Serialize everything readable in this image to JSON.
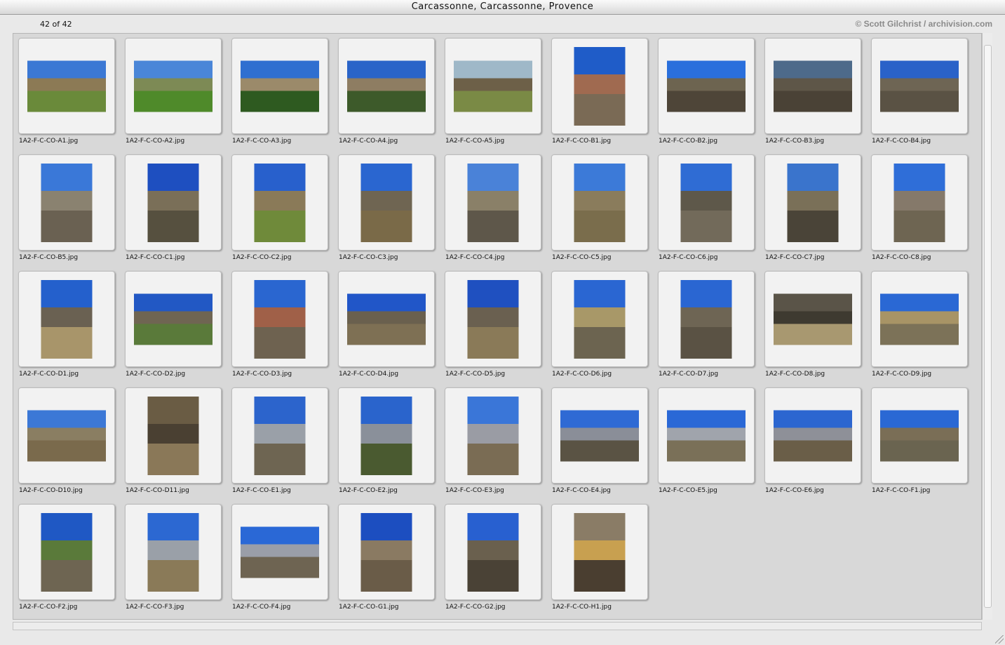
{
  "window": {
    "title": "Carcassonne, Carcassonne, Provence"
  },
  "header": {
    "counter": "42 of 42",
    "credit": "© Scott Gilchrist / archivision.com"
  },
  "thumbnails": [
    {
      "file": "1A2-F-C-CO-A1.jpg",
      "orient": "landscape",
      "sky": "#3b78d4",
      "fill": "#6a8a3a",
      "band": "#8c7a55"
    },
    {
      "file": "1A2-F-C-CO-A2.jpg",
      "orient": "landscape",
      "sky": "#4a86d8",
      "fill": "#4f8a2a",
      "band": "#7d8a55"
    },
    {
      "file": "1A2-F-C-CO-A3.jpg",
      "orient": "landscape",
      "sky": "#2f6fd0",
      "fill": "#2e5a20",
      "band": "#9b8a6a"
    },
    {
      "file": "1A2-F-C-CO-A4.jpg",
      "orient": "landscape",
      "sky": "#2a64c8",
      "fill": "#3d5a2a",
      "band": "#8e7d62"
    },
    {
      "file": "1A2-F-C-CO-A5.jpg",
      "orient": "landscape",
      "sky": "#9fb8c8",
      "fill": "#7a8a45",
      "band": "#6d6048"
    },
    {
      "file": "1A2-F-C-CO-B1.jpg",
      "orient": "portrait",
      "sky": "#1f5cc8",
      "fill": "#7a6a55",
      "band": "#a06a50"
    },
    {
      "file": "1A2-F-C-CO-B2.jpg",
      "orient": "landscape",
      "sky": "#2a6fdc",
      "fill": "#4e4538",
      "band": "#6d6450"
    },
    {
      "file": "1A2-F-C-CO-B3.jpg",
      "orient": "landscape",
      "sky": "#4d6a8a",
      "fill": "#4a4236",
      "band": "#5e5648"
    },
    {
      "file": "1A2-F-C-CO-B4.jpg",
      "orient": "landscape",
      "sky": "#2a62c8",
      "fill": "#5a5244",
      "band": "#6e6554"
    },
    {
      "file": "1A2-F-C-CO-B5.jpg",
      "orient": "portrait",
      "sky": "#3a78d8",
      "fill": "#6a6152",
      "band": "#8a8270"
    },
    {
      "file": "1A2-F-C-CO-C1.jpg",
      "orient": "portrait",
      "sky": "#1e4fc0",
      "fill": "#56503f",
      "band": "#7a6f58"
    },
    {
      "file": "1A2-F-C-CO-C2.jpg",
      "orient": "portrait",
      "sky": "#2860cc",
      "fill": "#6f8a3a",
      "band": "#8a7a58"
    },
    {
      "file": "1A2-F-C-CO-C3.jpg",
      "orient": "portrait",
      "sky": "#2a66d0",
      "fill": "#7a6a48",
      "band": "#6f6552"
    },
    {
      "file": "1A2-F-C-CO-C4.jpg",
      "orient": "portrait",
      "sky": "#4a82d8",
      "fill": "#5e574a",
      "band": "#8a8068"
    },
    {
      "file": "1A2-F-C-CO-C5.jpg",
      "orient": "portrait",
      "sky": "#3c7ad8",
      "fill": "#7a6d4c",
      "band": "#8a7c5c"
    },
    {
      "file": "1A2-F-C-CO-C6.jpg",
      "orient": "portrait",
      "sky": "#2f6cd4",
      "fill": "#726a5a",
      "band": "#5e584a"
    },
    {
      "file": "1A2-F-C-CO-C7.jpg",
      "orient": "portrait",
      "sky": "#3a74cc",
      "fill": "#4a4438",
      "band": "#7a7058"
    },
    {
      "file": "1A2-F-C-CO-C8.jpg",
      "orient": "portrait",
      "sky": "#2f6ed8",
      "fill": "#6e6552",
      "band": "#85796a"
    },
    {
      "file": "1A2-F-C-CO-D1.jpg",
      "orient": "portrait",
      "sky": "#2460cc",
      "fill": "#a8956a",
      "band": "#6a6152"
    },
    {
      "file": "1A2-F-C-CO-D2.jpg",
      "orient": "landscape",
      "sky": "#2258c4",
      "fill": "#5a7a3a",
      "band": "#6f6552"
    },
    {
      "file": "1A2-F-C-CO-D3.jpg",
      "orient": "portrait",
      "sky": "#2a66d0",
      "fill": "#6e6250",
      "band": "#a06048"
    },
    {
      "file": "1A2-F-C-CO-D4.jpg",
      "orient": "landscape",
      "sky": "#2156c8",
      "fill": "#7e7054",
      "band": "#6a604e"
    },
    {
      "file": "1A2-F-C-CO-D5.jpg",
      "orient": "portrait",
      "sky": "#1f50c0",
      "fill": "#8a7a58",
      "band": "#6a6050"
    },
    {
      "file": "1A2-F-C-CO-D6.jpg",
      "orient": "portrait",
      "sky": "#2a66d2",
      "fill": "#6c6450",
      "band": "#a89868"
    },
    {
      "file": "1A2-F-C-CO-D7.jpg",
      "orient": "portrait",
      "sky": "#2a66d2",
      "fill": "#5a5244",
      "band": "#6e6554"
    },
    {
      "file": "1A2-F-C-CO-D8.jpg",
      "orient": "landscape",
      "sky": "#5a5448",
      "fill": "#a89870",
      "band": "#3e3a30"
    },
    {
      "file": "1A2-F-C-CO-D9.jpg",
      "orient": "landscape",
      "sky": "#2a68d4",
      "fill": "#7c7258",
      "band": "#a89466"
    },
    {
      "file": "1A2-F-C-CO-D10.jpg",
      "orient": "landscape",
      "sky": "#3c78d6",
      "fill": "#7a6a4c",
      "band": "#8a7e62"
    },
    {
      "file": "1A2-F-C-CO-D11.jpg",
      "orient": "portrait",
      "sky": "#6a5c44",
      "fill": "#8a7858",
      "band": "#4a4032"
    },
    {
      "file": "1A2-F-C-CO-E1.jpg",
      "orient": "portrait",
      "sky": "#2c64cc",
      "fill": "#6e6552",
      "band": "#9aa0a8"
    },
    {
      "file": "1A2-F-C-CO-E2.jpg",
      "orient": "portrait",
      "sky": "#2a64cc",
      "fill": "#4a5a30",
      "band": "#8a909a"
    },
    {
      "file": "1A2-F-C-CO-E3.jpg",
      "orient": "portrait",
      "sky": "#3a76d8",
      "fill": "#7a6c54",
      "band": "#9a9ca4"
    },
    {
      "file": "1A2-F-C-CO-E4.jpg",
      "orient": "landscape",
      "sky": "#2f6ad4",
      "fill": "#5a5344",
      "band": "#8a8e98"
    },
    {
      "file": "1A2-F-C-CO-E5.jpg",
      "orient": "landscape",
      "sky": "#2a68d6",
      "fill": "#7a7058",
      "band": "#a0a4ac"
    },
    {
      "file": "1A2-F-C-CO-E6.jpg",
      "orient": "landscape",
      "sky": "#2c66d0",
      "fill": "#6a5e48",
      "band": "#8e9098"
    },
    {
      "file": "1A2-F-C-CO-F1.jpg",
      "orient": "landscape",
      "sky": "#2a68d4",
      "fill": "#6a6450",
      "band": "#7a6e56"
    },
    {
      "file": "1A2-F-C-CO-F2.jpg",
      "orient": "portrait",
      "sky": "#1f58c4",
      "fill": "#6e6552",
      "band": "#5a7a3a"
    },
    {
      "file": "1A2-F-C-CO-F3.jpg",
      "orient": "portrait",
      "sky": "#2c68d2",
      "fill": "#8a7a58",
      "band": "#9aa0a8"
    },
    {
      "file": "1A2-F-C-CO-F4.jpg",
      "orient": "landscape",
      "sky": "#2a68d6",
      "fill": "#6e6452",
      "band": "#9a9ea8"
    },
    {
      "file": "1A2-F-C-CO-G1.jpg",
      "orient": "portrait",
      "sky": "#1c4ec0",
      "fill": "#6a5c48",
      "band": "#8a7a62"
    },
    {
      "file": "1A2-F-C-CO-G2.jpg",
      "orient": "portrait",
      "sky": "#2860d0",
      "fill": "#4a4236",
      "band": "#6a604e"
    },
    {
      "file": "1A2-F-C-CO-H1.jpg",
      "orient": "portrait",
      "sky": "#8a7c66",
      "fill": "#4a3e30",
      "band": "#c8a050"
    }
  ]
}
